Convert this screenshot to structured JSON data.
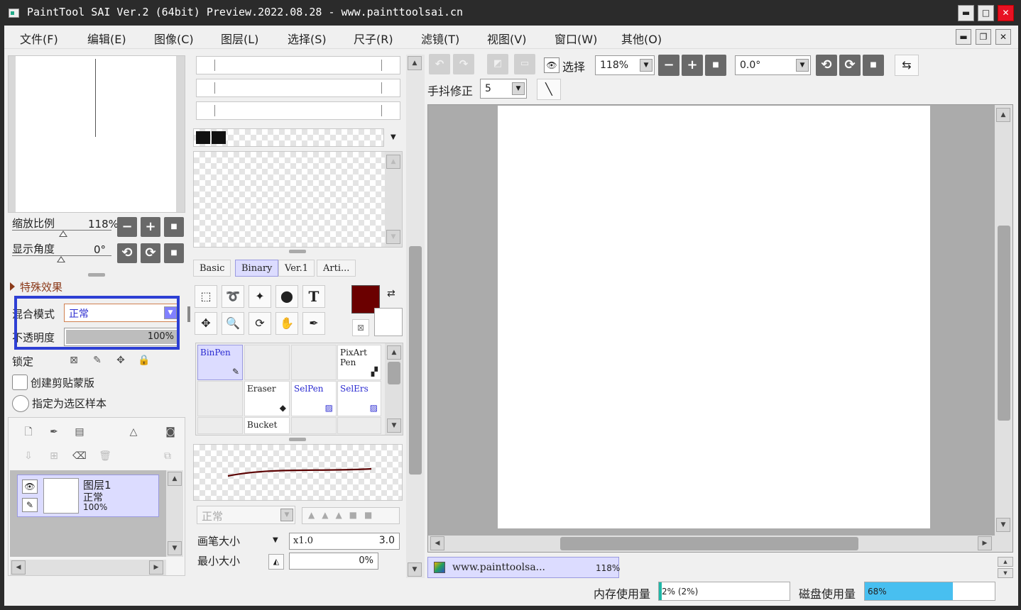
{
  "window": {
    "title": "PaintTool SAI Ver.2 (64bit) Preview.2022.08.28 - www.painttoolsai.cn",
    "minimize": "▬",
    "maximize": "□",
    "close": "✕"
  },
  "menubar": {
    "items": [
      "文件(F)",
      "编辑(E)",
      "图像(C)",
      "图层(L)",
      "选择(S)",
      "尺子(R)",
      "滤镜(T)",
      "视图(V)",
      "窗口(W)",
      "其他(O)"
    ],
    "mdi_min": "▬",
    "mdi_restore": "❐",
    "mdi_close": "✕"
  },
  "navigator": {
    "zoom_label": "缩放比例",
    "zoom_value": "118%",
    "angle_label": "显示角度",
    "angle_value": "0°",
    "zoom_minus": "−",
    "zoom_plus": "+",
    "zoom_reset": "■",
    "rot_left": "⟲",
    "rot_right": "⟳",
    "rot_reset": "■"
  },
  "layer_props": {
    "section": "特殊效果",
    "blend_label": "混合模式",
    "blend_value": "正常",
    "opacity_label": "不透明度",
    "opacity_value": "100%",
    "opacity_level": 1.0,
    "lock_label": "锁定",
    "clip_label": "创建剪贴蒙版",
    "sample_label": "指定为选区样本"
  },
  "layers": [
    {
      "name": "图层1",
      "mode": "正常",
      "opacity": "100%"
    }
  ],
  "colors": {
    "primary": "#6b0000",
    "secondary": "#ffffff",
    "highlight_box": "#2d3fd4",
    "layer_selected": "#dcdcff",
    "mem_fill": "#20b8a8",
    "disk_fill": "#48bff0"
  },
  "brush_tabs": [
    "Basic",
    "Binary",
    "Ver.1",
    "Arti..."
  ],
  "brushes": [
    [
      "BinPen",
      "",
      "",
      "PixArt Pen"
    ],
    [
      "",
      "Eraser",
      "SelPen",
      "SelErs"
    ],
    [
      "",
      "Bucket",
      "",
      ""
    ]
  ],
  "brush_settings": {
    "mode": "正常",
    "size_label": "画笔大小",
    "size_mult": "x1.0",
    "size_value": "3.0",
    "minsize_label": "最小大小",
    "minsize_value": "0%"
  },
  "toolbar": {
    "select_label": "选择",
    "zoom": "118%",
    "angle": "0.0°",
    "stab_label": "手抖修正",
    "stab_value": "5"
  },
  "canvas_tab": {
    "name": "www.painttoolsa...",
    "zoom": "118%"
  },
  "status": {
    "mem_label": "内存使用量",
    "mem_value": "2% (2%)",
    "mem_level": 0.02,
    "disk_label": "磁盘使用量",
    "disk_value": "68%",
    "disk_level": 0.68
  }
}
